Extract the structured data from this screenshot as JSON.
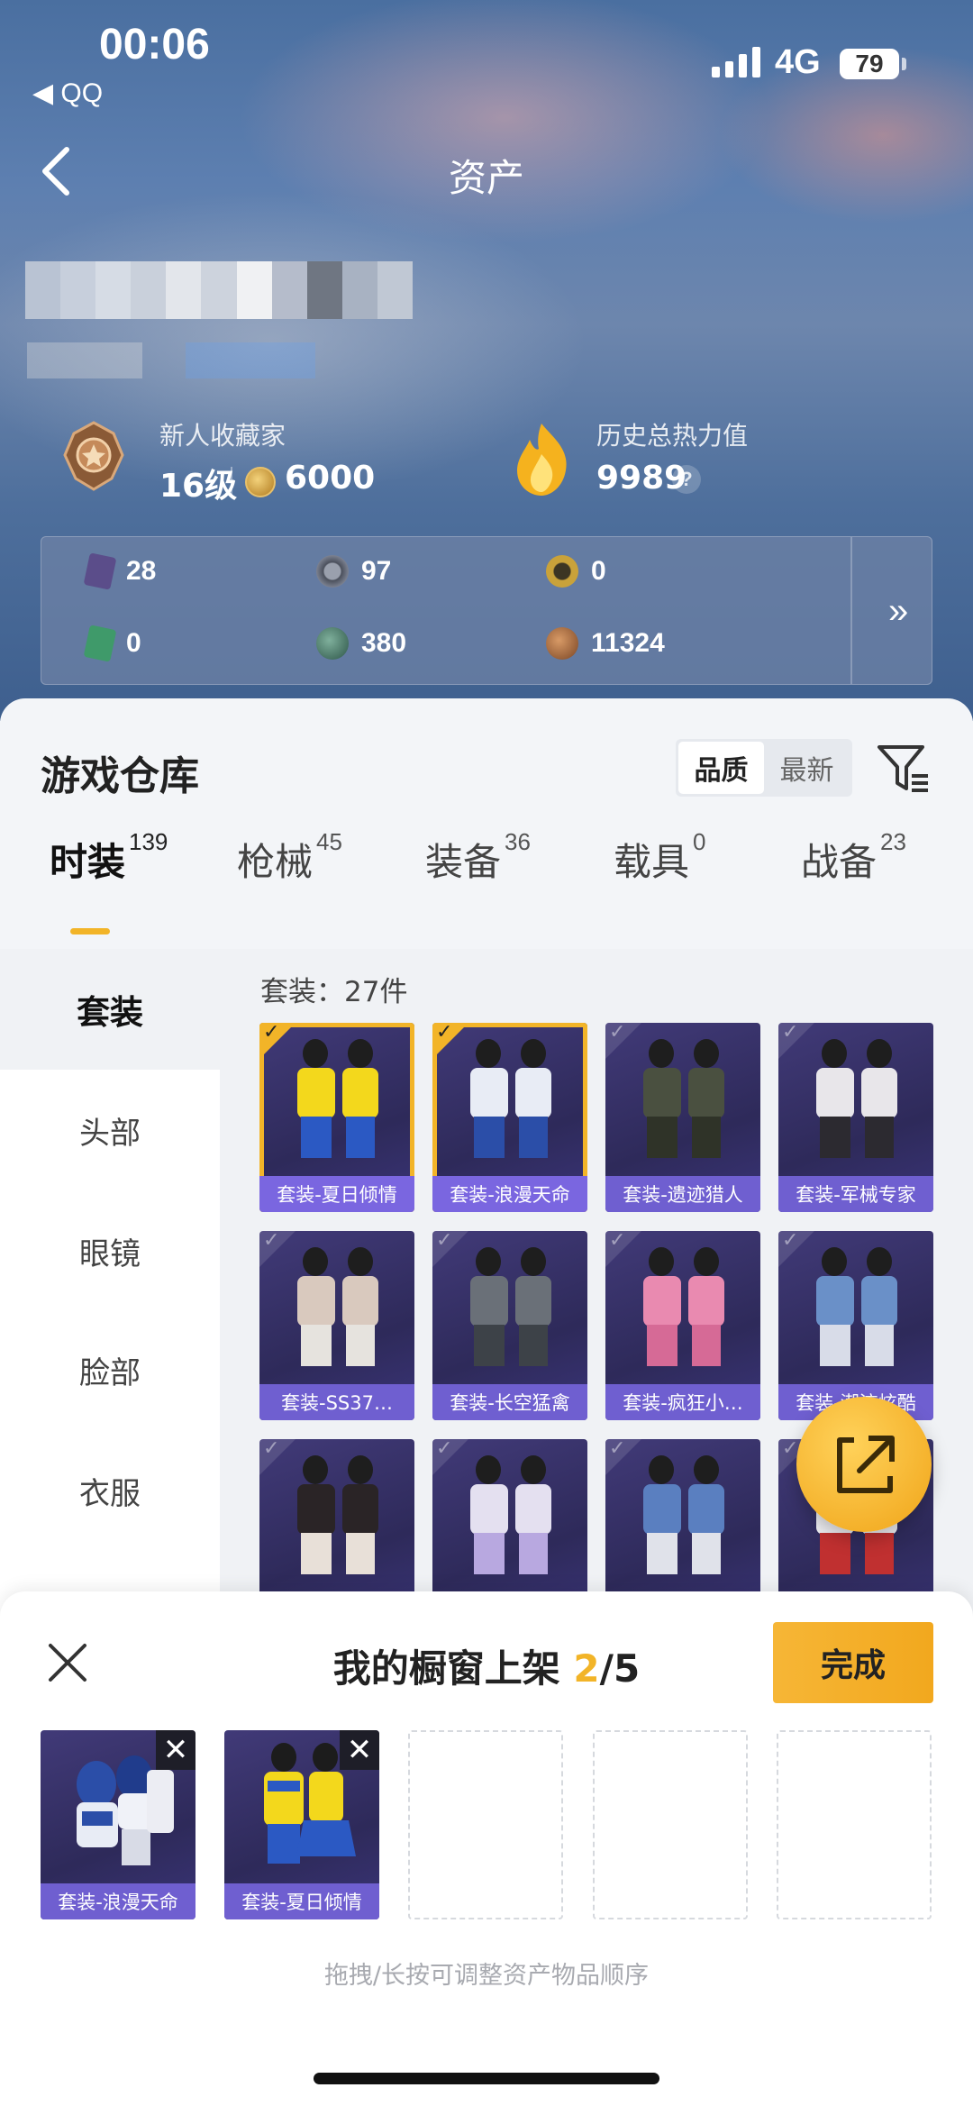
{
  "status_bar": {
    "time": "00:06",
    "back_app": "◀ QQ",
    "network": "4G",
    "battery": "79"
  },
  "header": {
    "title": "资产",
    "back_icon": "chevron-left-icon"
  },
  "profile": {
    "rank_title": "新人收藏家",
    "level": "16级",
    "coins": "6000",
    "heat_title": "历史总热力值",
    "heat_value": "9989",
    "help": "?"
  },
  "stats": {
    "items": [
      {
        "value": "28",
        "icon": "card-icon",
        "color": "#5b4d8a"
      },
      {
        "value": "97",
        "icon": "silver-coin-icon",
        "color": "#7b8190"
      },
      {
        "value": "0",
        "icon": "gold-token-icon",
        "color": "#c9a23a"
      },
      {
        "value": "0",
        "icon": "green-card-icon",
        "color": "#3f9a6a"
      },
      {
        "value": "380",
        "icon": "green-coin-icon",
        "color": "#3d7060"
      },
      {
        "value": "11324",
        "icon": "bronze-coin-icon",
        "color": "#a0643a"
      }
    ],
    "more": "»"
  },
  "warehouse": {
    "title": "游戏仓库",
    "sort": [
      "品质",
      "最新"
    ],
    "sort_active": "品质",
    "tabs": [
      {
        "label": "时装",
        "count": "139"
      },
      {
        "label": "枪械",
        "count": "45"
      },
      {
        "label": "装备",
        "count": "36"
      },
      {
        "label": "载具",
        "count": "0"
      },
      {
        "label": "战备",
        "count": "23"
      }
    ],
    "categories": [
      "套装",
      "头部",
      "眼镜",
      "脸部",
      "衣服"
    ],
    "count_label": "套装：27件",
    "items": [
      {
        "label": "套装-夏日倾情",
        "selected": true
      },
      {
        "label": "套装-浪漫天命",
        "selected": true
      },
      {
        "label": "套装-遗迹猎人",
        "selected": false
      },
      {
        "label": "套装-军械专家",
        "selected": false
      },
      {
        "label": "套装-SS37…",
        "selected": false
      },
      {
        "label": "套装-长空猛禽",
        "selected": false
      },
      {
        "label": "套装-疯狂小…",
        "selected": false
      },
      {
        "label": "套装-潮流炫酷",
        "selected": false
      },
      {
        "label": "",
        "selected": false
      },
      {
        "label": "",
        "selected": false
      },
      {
        "label": "",
        "selected": false
      },
      {
        "label": "",
        "selected": false
      }
    ]
  },
  "showcase": {
    "title": "我的橱窗上架",
    "current": "2",
    "total": "/5",
    "done_label": "完成",
    "slots": [
      {
        "label": "套装-浪漫天命"
      },
      {
        "label": "套装-夏日倾情"
      }
    ],
    "hint": "拖拽/长按可调整资产物品顺序"
  },
  "colors": {
    "accent": "#f2b428",
    "card_bg": "#2e2a5a",
    "card_label": "#6f5fd0"
  }
}
